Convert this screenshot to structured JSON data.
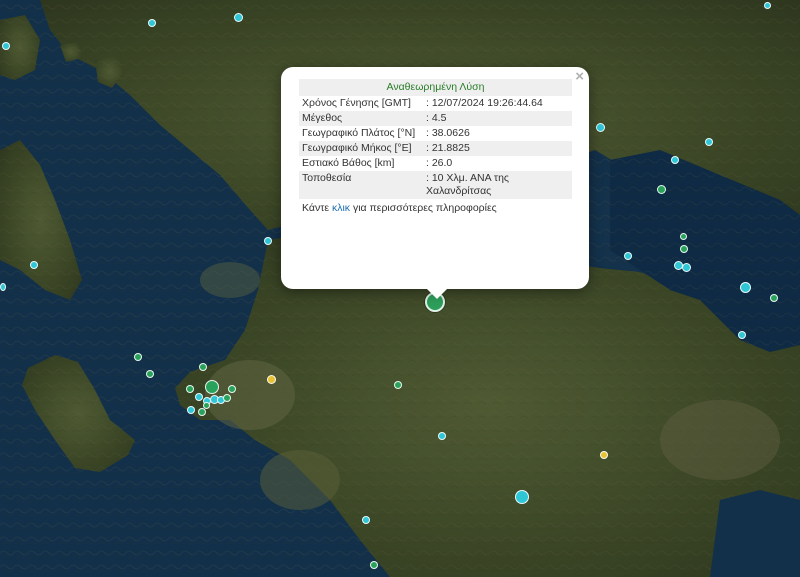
{
  "popup": {
    "title": "Αναθεωρημένη Λύση",
    "close_symbol": "×",
    "rows": [
      {
        "label": "Χρόνος Γένησης [GMT]",
        "value": ": 12/07/2024 19:26:44.64"
      },
      {
        "label": "Μέγεθος",
        "value": ": 4.5"
      },
      {
        "label": "Γεωγραφικό Πλάτος [°N]",
        "value": ": 38.0626"
      },
      {
        "label": "Γεωγραφικό Μήκος [°E]",
        "value": ": 21.8825"
      },
      {
        "label": "Εστιακό Βάθος [km]",
        "value": ": 26.0"
      },
      {
        "label": "Τοποθεσία",
        "value": ": 10 Χλμ. ΑΝΑ της Χαλανδρίτσας"
      }
    ],
    "more_prefix": "Κάντε ",
    "more_link": "κλικ",
    "more_suffix": " για περισσότερες πληροφορίες"
  },
  "colors": {
    "sea": "#13304a",
    "land": "#3e4a2a",
    "quake_cyan": "#2fc6d6",
    "quake_green": "#29a35c",
    "quake_yellow": "#e6c234",
    "title_green": "#2a7d2a",
    "link_blue": "#1f6fb2"
  }
}
